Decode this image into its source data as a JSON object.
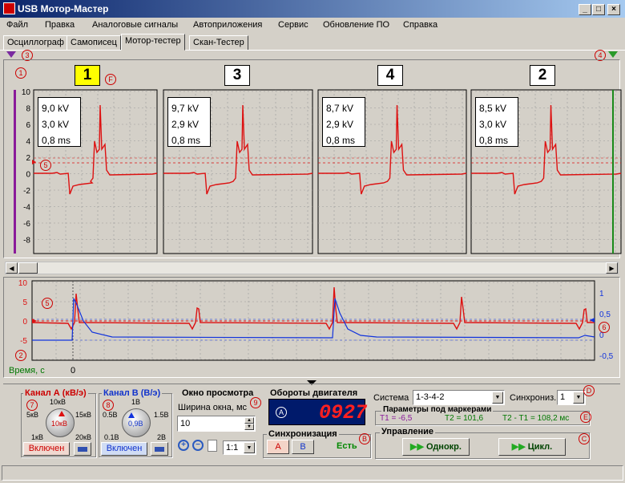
{
  "window": {
    "title": "USB Мотор-Мастер",
    "min": "_",
    "max": "□",
    "close": "×"
  },
  "menu": [
    "Файл",
    "Правка",
    "Аналоговые сигналы",
    "Автоприложения",
    "Сервис",
    "Обновление ПО",
    "Справка"
  ],
  "tabs": [
    "Осциллограф",
    "Самописец",
    "Мотор-тестер",
    "Скан-Тестер"
  ],
  "markers": {
    "m1": "1",
    "m3": "3",
    "m4": "4",
    "m5": "5",
    "m2": "2",
    "m6": "6",
    "mF": "F",
    "m7": "7",
    "m8": "8",
    "m9": "9",
    "mA": "A",
    "mB": "B",
    "mC": "C",
    "mD": "D",
    "mE": "E"
  },
  "cylinders": [
    {
      "num": "1",
      "highlight": true,
      "kv": "9,0 kV",
      "kv2": "3,0 kV",
      "ms": "0,8 ms"
    },
    {
      "num": "3",
      "highlight": false,
      "kv": "9,7 kV",
      "kv2": "2,9 kV",
      "ms": "0,8 ms"
    },
    {
      "num": "4",
      "highlight": false,
      "kv": "8,7 kV",
      "kv2": "2,9 kV",
      "ms": "0,8 ms"
    },
    {
      "num": "2",
      "highlight": false,
      "kv": "8,5 kV",
      "kv2": "3,0 kV",
      "ms": "0,8 ms"
    }
  ],
  "yaxis_top": [
    "10",
    "8",
    "6",
    "4",
    "2",
    "0",
    "-2",
    "-4",
    "-6",
    "-8"
  ],
  "yaxis_bottom_left": [
    "10",
    "5",
    "0",
    "-5"
  ],
  "yaxis_bottom_right": [
    "1",
    "0,5",
    "0",
    "-0,5"
  ],
  "time_label": "Время, с",
  "time_zero": "0",
  "channelA": {
    "title": "Канал А (кВ/э)",
    "t10": "10кВ",
    "t5": "5кВ",
    "t15": "15кВ",
    "t1": "1кВ",
    "t20": "20кВ",
    "center": "10кВ",
    "on": "Включен"
  },
  "channelB": {
    "title": "Канал В (В/э)",
    "t1": "1В",
    "t05": "0.5В",
    "t15": "1.5В",
    "t01": "0.1В",
    "t2": "2В",
    "center": "0,9В",
    "on": "Включен"
  },
  "window_view": {
    "title": "Окно просмотра",
    "width_label": "Ширина окна, мс",
    "width_value": "10",
    "scale": "1:1"
  },
  "rpm": {
    "title": "Обороты двигателя",
    "value": "0927"
  },
  "sync": {
    "title": "Синхронизация",
    "a": "А",
    "b": "В",
    "status": "Есть"
  },
  "system": {
    "label": "Система",
    "value": "1-3-4-2",
    "sync_label": "Синхрониз.",
    "sync_value": "1"
  },
  "params": {
    "title": "Параметры под маркерами",
    "t1": "Т1 = -6,5",
    "t2": "Т2 = 101,6",
    "dt": "Т2 - Т1 = 108,2 мс"
  },
  "control": {
    "title": "Управление",
    "single": "Однокр.",
    "cycle": "Цикл."
  },
  "colors": {
    "red": "#dd1111",
    "blue": "#1133dd",
    "green": "#007700",
    "rpm_bg": "#001a6b",
    "rpm_fg": "#ff2020"
  }
}
